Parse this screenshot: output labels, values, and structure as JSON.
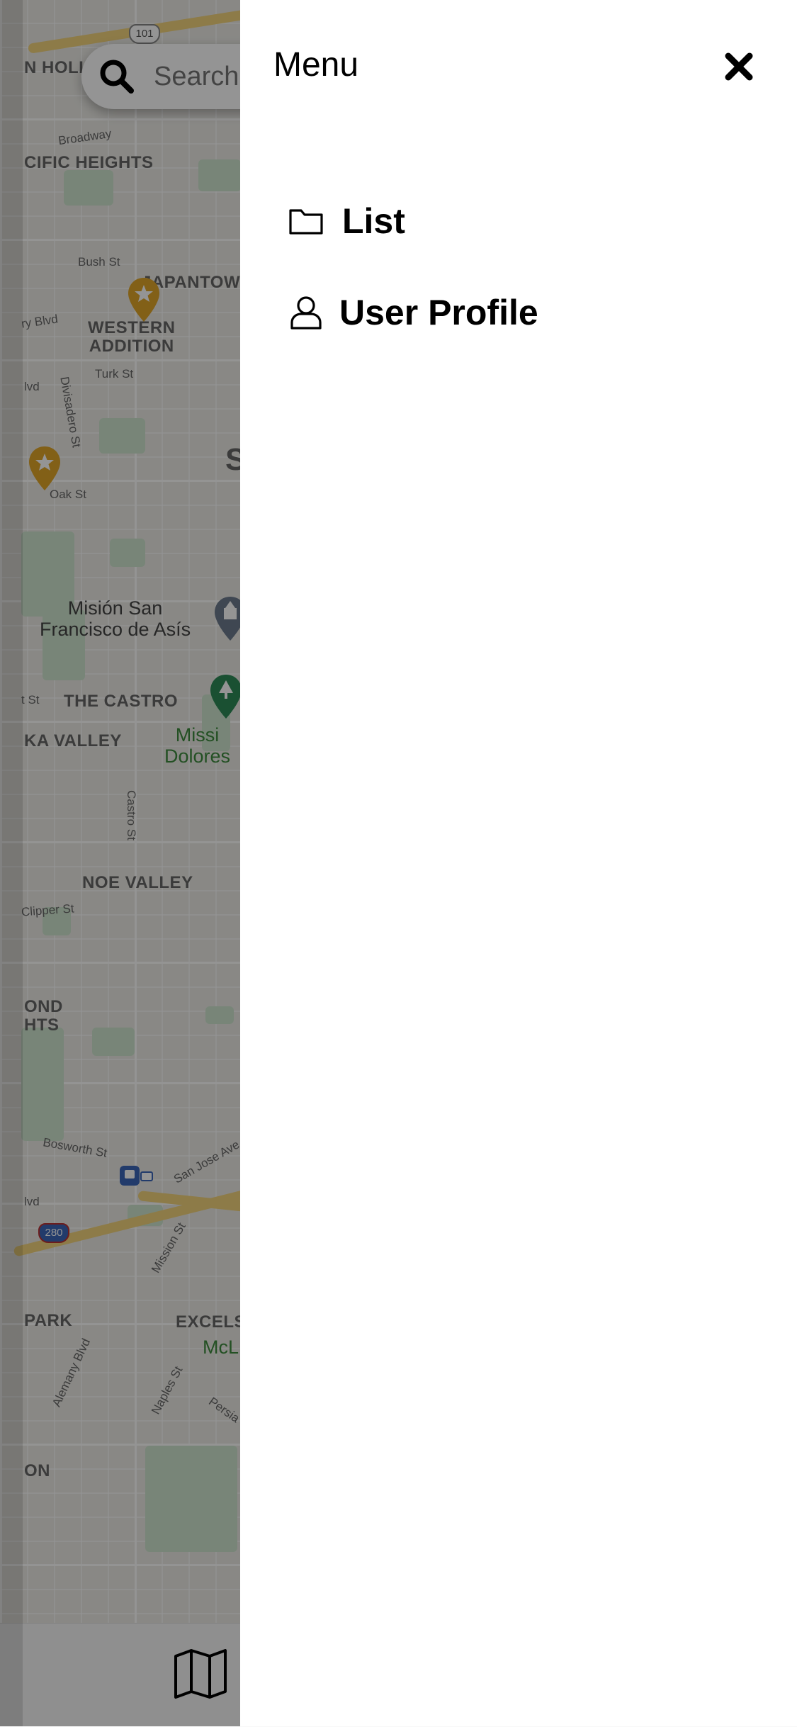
{
  "map": {
    "labels": {
      "hollywood": "N HOLL",
      "pacific_heights": "CIFIC HEIGHTS",
      "broadway": "Broadway",
      "bush": "Bush St",
      "japantown": "JAPANTOWN",
      "geary": "ry Blvd",
      "western_addition": "WESTERN\nADDITION",
      "turk": "Turk St",
      "divisadero": "Divisadero St",
      "blvd_left": "lvd",
      "oak": "Oak St",
      "mision": "Misión San\nFrancisco de Asís",
      "castro": "THE CASTRO",
      "st_left": "t St",
      "eureka_valley": "KA VALLEY",
      "mission_dolores": "Missi\nDolores",
      "castro_st": "Castro St",
      "noe_valley": "NOE VALLEY",
      "clipper": "Clipper St",
      "diamond_heights": "OND\nHTS",
      "bosworth": "Bosworth St",
      "san_jose": "San Jose Ave",
      "blvd_left2": "lvd",
      "mission_st": "Mission St",
      "park": "PARK",
      "excelsior": "EXCELS",
      "mclaren": "McL",
      "alemany": "Alemany Blvd",
      "naples": "Naples St",
      "persia": "Persia",
      "on": "ON",
      "s_letter": "S",
      "us101": "101",
      "i280": "280"
    }
  },
  "search": {
    "placeholder": "Search"
  },
  "tabbar": {
    "map_icon": "map-icon"
  },
  "drawer": {
    "title": "Menu",
    "close_icon": "close-icon",
    "items": [
      {
        "label": "List",
        "icon": "folder-icon"
      },
      {
        "label": "User Profile",
        "icon": "user-icon"
      }
    ]
  },
  "colors": {
    "overlay": "rgba(0,0,0,0.42)",
    "drawer_bg": "#ffffff",
    "pin_gold": "#e0a528",
    "pin_green": "#2e8b57",
    "pin_gray": "#6d7b8d"
  }
}
